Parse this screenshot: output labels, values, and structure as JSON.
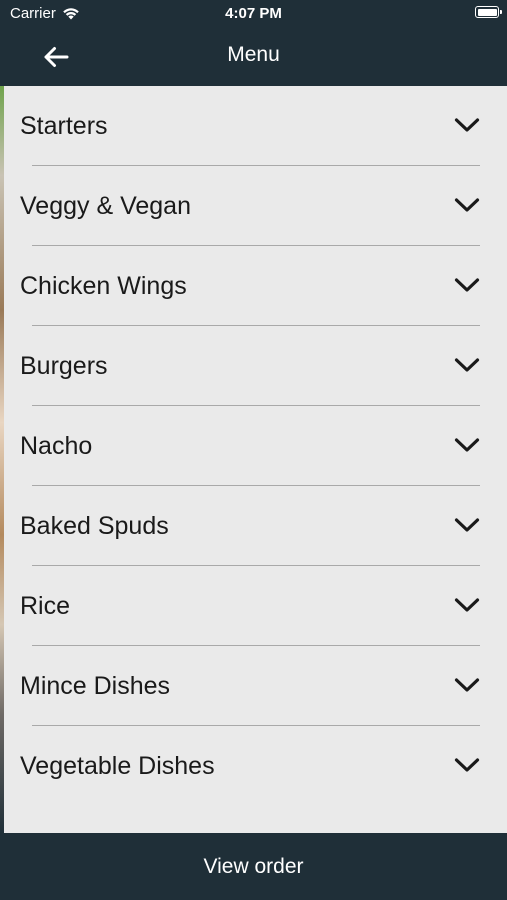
{
  "status_bar": {
    "carrier": "Carrier",
    "time": "4:07 PM",
    "wifi_icon": "wifi-icon",
    "battery_icon": "battery-icon"
  },
  "nav": {
    "title": "Menu",
    "back_icon": "arrow-left-icon"
  },
  "menu": {
    "items": [
      {
        "label": "Starters"
      },
      {
        "label": "Veggy & Vegan"
      },
      {
        "label": "Chicken Wings"
      },
      {
        "label": "Burgers"
      },
      {
        "label": "Nacho"
      },
      {
        "label": "Baked Spuds"
      },
      {
        "label": "Rice"
      },
      {
        "label": "Mince Dishes"
      },
      {
        "label": "Vegetable Dishes"
      }
    ],
    "expand_icon": "chevron-down-icon"
  },
  "footer": {
    "view_order_label": "View order"
  },
  "colors": {
    "header_bg": "#1f2f38",
    "list_bg": "#eaeaea",
    "divider": "#a9a9a9",
    "text": "#1a1a1a"
  }
}
